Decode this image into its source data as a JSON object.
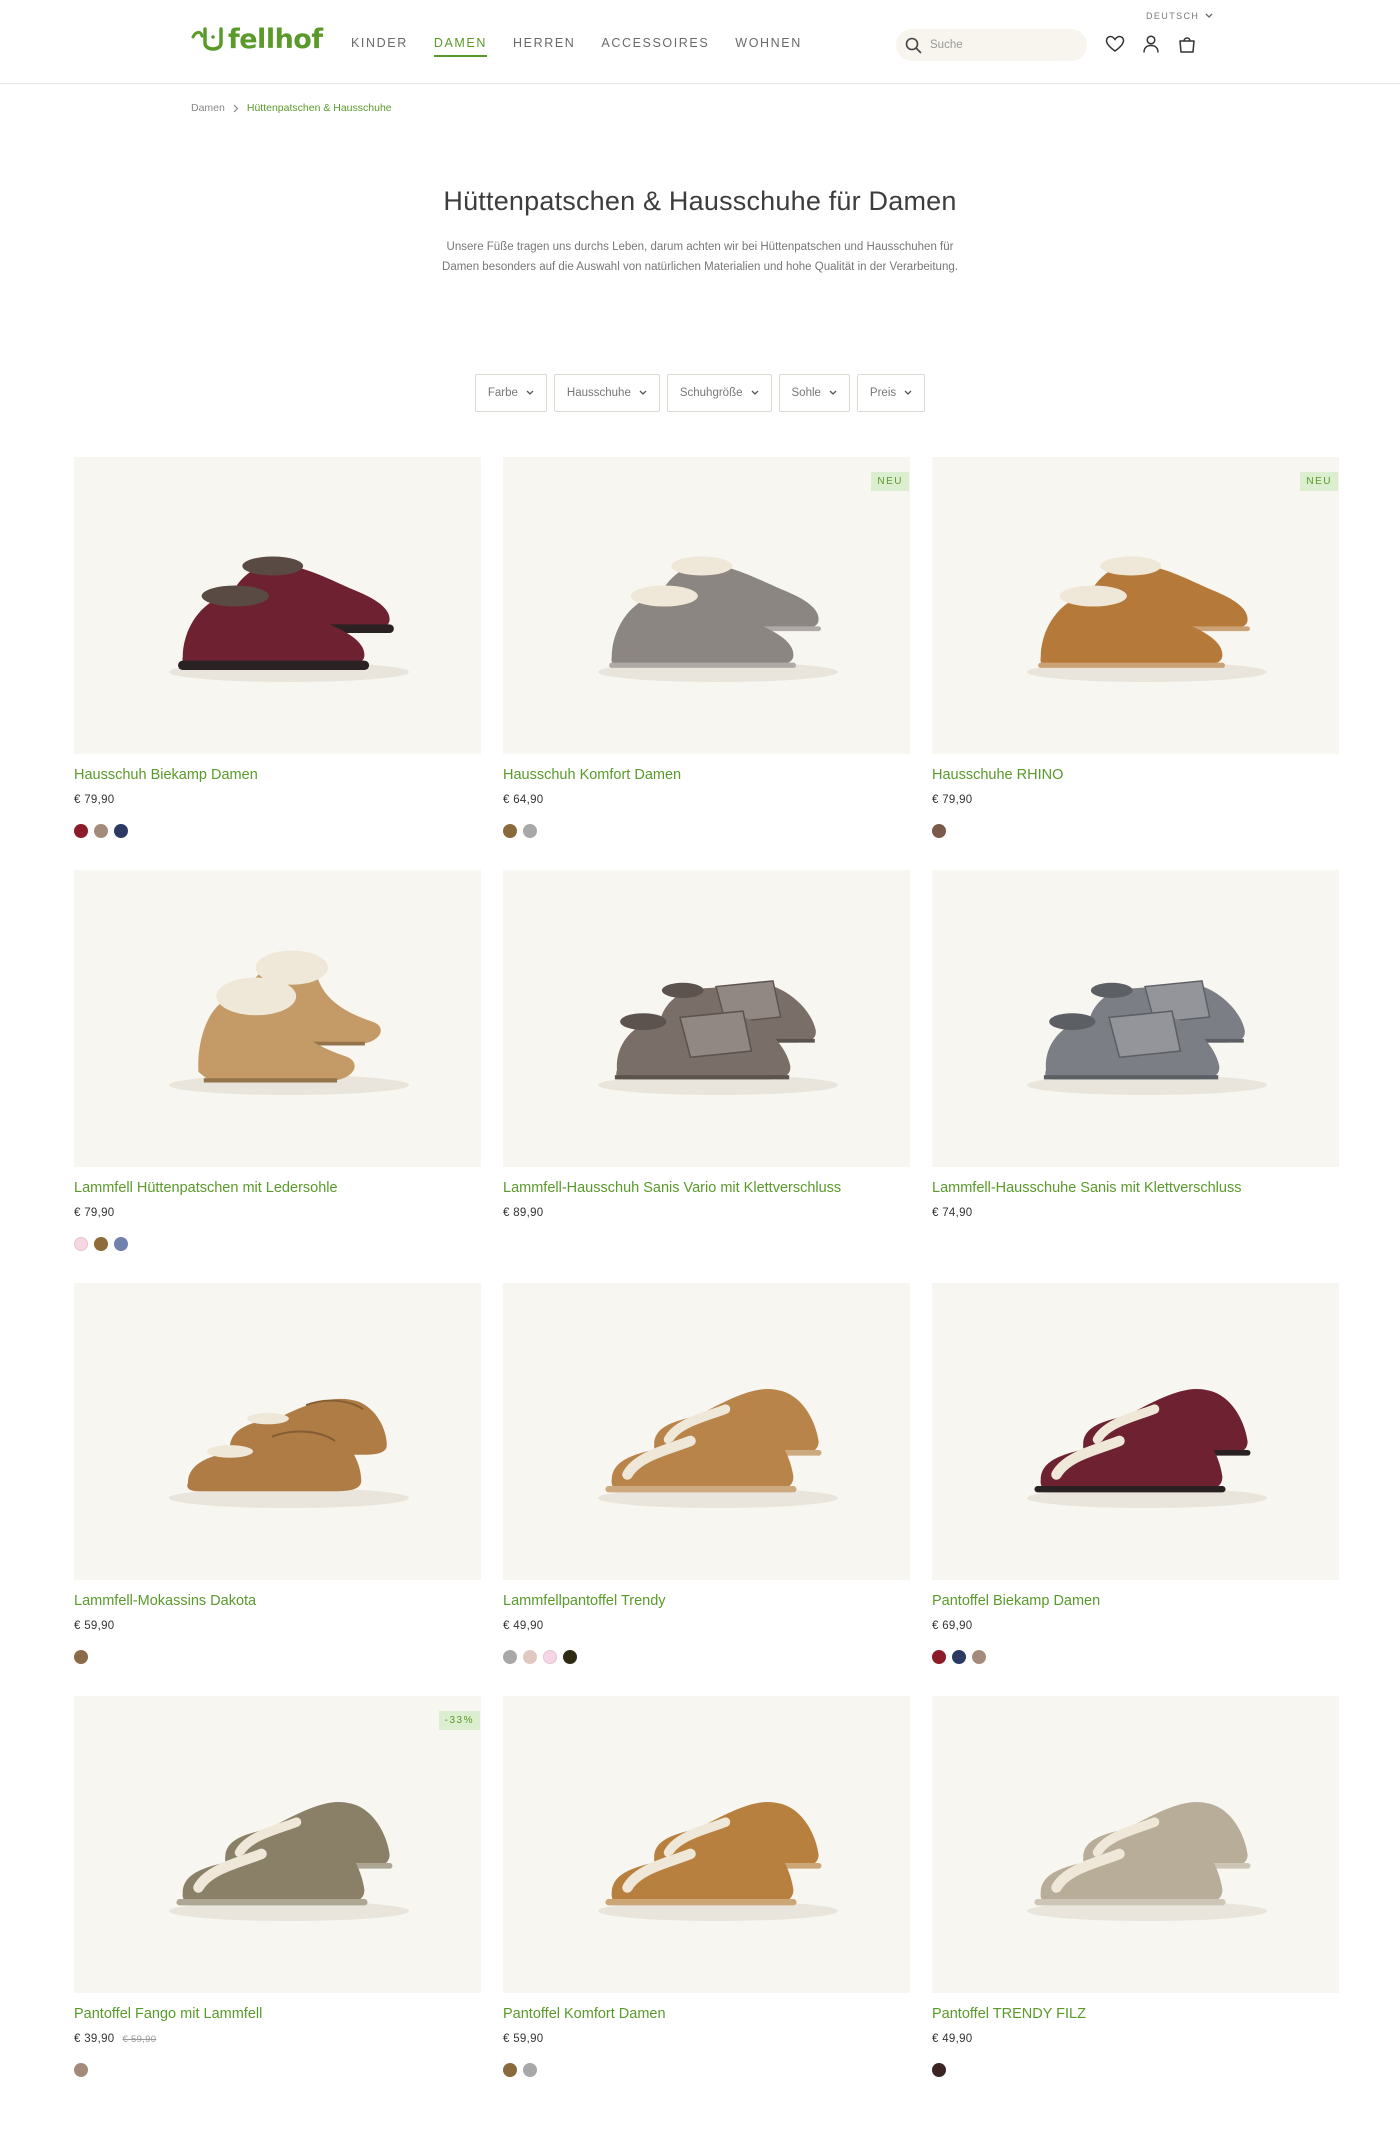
{
  "header": {
    "logo_text": "fellhof",
    "nav": [
      "KINDER",
      "DAMEN",
      "HERREN",
      "ACCESSOIRES",
      "WOHNEN"
    ],
    "active_nav": "DAMEN",
    "search_placeholder": "Suche",
    "language": "DEUTSCH",
    "icons": [
      "heart-icon",
      "user-icon",
      "bag-icon"
    ]
  },
  "breadcrumb": {
    "home": "Damen",
    "current": "Hüttenpatschen & Hausschuhe"
  },
  "page": {
    "title": "Hüttenpatschen & Hausschuhe für Damen",
    "description": "Unsere Füße tragen uns durchs Leben, darum achten wir bei Hüttenpatschen und Hausschuhen für Damen besonders auf die Auswahl von natürlichen Materialien und hohe Qualität in der Verarbeitung."
  },
  "filters": [
    "Farbe",
    "Hausschuhe",
    "Schuhgröße",
    "Sohle",
    "Preis"
  ],
  "products": [
    {
      "name": "Hausschuh Biekamp Damen",
      "price": "€ 79,90",
      "old_price": "",
      "badge": "",
      "colors": [
        "#8c1c2a",
        "#a48a7a",
        "#2c3a63"
      ],
      "shoe_color": "#6e2130",
      "style": "loafer"
    },
    {
      "name": "Hausschuh Komfort Damen",
      "price": "€ 64,90",
      "old_price": "",
      "badge": "NEU",
      "colors": [
        "#8a6a3c",
        "#a8a8a8"
      ],
      "shoe_color": "#8c8682",
      "style": "bootie"
    },
    {
      "name": "Hausschuhe RHINO",
      "price": "€ 79,90",
      "old_price": "",
      "badge": "NEU",
      "colors": [
        "#7a5a4a"
      ],
      "shoe_color": "#b57a3a",
      "style": "bootie"
    },
    {
      "name": "Lammfell Hüttenpatschen mit Ledersohle",
      "price": "€ 79,90",
      "old_price": "",
      "badge": "",
      "colors": [
        "#f6d6e2",
        "#8f6a3a",
        "#7082ab"
      ],
      "shoe_color": "#c49a66",
      "style": "boot"
    },
    {
      "name": "Lammfell-Hausschuh Sanis Vario mit Klettverschluss",
      "price": "€ 89,90",
      "old_price": "",
      "badge": "",
      "colors": [],
      "shoe_color": "#7a6e68",
      "style": "velcro"
    },
    {
      "name": "Lammfell-Hausschuhe Sanis mit Klettverschluss",
      "price": "€ 74,90",
      "old_price": "",
      "badge": "",
      "colors": [],
      "shoe_color": "#7b7e84",
      "style": "velcro"
    },
    {
      "name": "Lammfell-Mokassins Dakota",
      "price": "€ 59,90",
      "old_price": "",
      "badge": "",
      "colors": [
        "#8a6a48"
      ],
      "shoe_color": "#b07c45",
      "style": "moccasin"
    },
    {
      "name": "Lammfellpantoffel Trendy",
      "price": "€ 49,90",
      "old_price": "",
      "badge": "",
      "colors": [
        "#a8a8a8",
        "#e0c8c0",
        "#f6d6e6",
        "#2e2a14"
      ],
      "shoe_color": "#b8844a",
      "style": "slipper"
    },
    {
      "name": "Pantoffel Biekamp Damen",
      "price": "€ 69,90",
      "old_price": "",
      "badge": "",
      "colors": [
        "#8c1c2a",
        "#2c3a63",
        "#a48a7a"
      ],
      "shoe_color": "#6e2130",
      "style": "mule"
    },
    {
      "name": "Pantoffel Fango mit Lammfell",
      "price": "€ 39,90",
      "old_price": "€ 59,90",
      "badge": "-33%",
      "colors": [
        "#a48a7a"
      ],
      "shoe_color": "#8a8068",
      "style": "slipper"
    },
    {
      "name": "Pantoffel Komfort Damen",
      "price": "€ 59,90",
      "old_price": "",
      "badge": "",
      "colors": [
        "#8a6a3c",
        "#a8a8a8"
      ],
      "shoe_color": "#b8803e",
      "style": "slipper"
    },
    {
      "name": "Pantoffel TRENDY FILZ",
      "price": "€ 49,90",
      "old_price": "",
      "badge": "",
      "colors": [
        "#3c2424"
      ],
      "shoe_color": "#b8ad98",
      "style": "slipper"
    }
  ]
}
